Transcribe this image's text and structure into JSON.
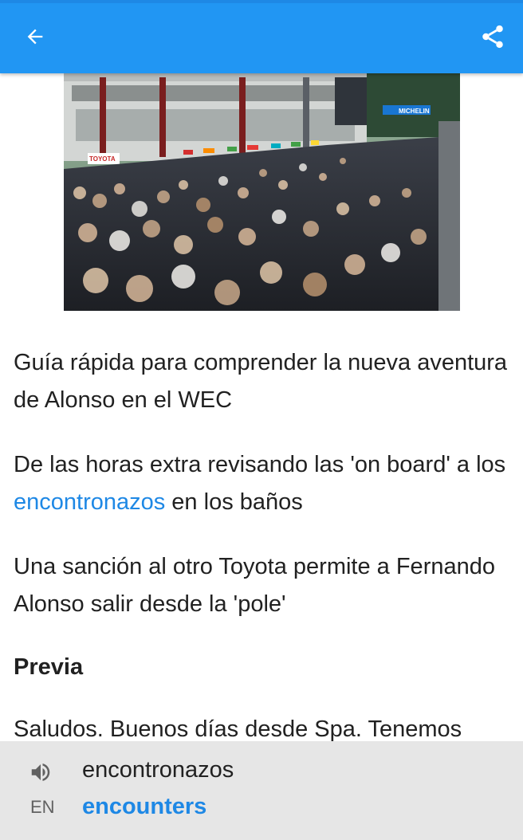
{
  "appbar": {
    "back_icon": "arrow-back-icon",
    "share_icon": "share-icon",
    "color": "#2196f3"
  },
  "hero_image": {
    "signage": [
      "TOYOTA",
      "MICHELIN"
    ]
  },
  "article": {
    "related_1": "Guía rápida para comprender la nueva aventura de Alonso en el WEC",
    "related_2_before": "De las horas extra revisando las 'on board' a los ",
    "related_2_link": "encontronazos",
    "related_2_after": " en los baños",
    "related_3": "Una sanción al otro Toyota permite a Fernando Alonso salir desde la 'pole'",
    "section_heading": "Previa",
    "intro": "Saludos. Buenos días desde Spa. Tenemos"
  },
  "translation": {
    "speaker_icon": "speaker-icon",
    "source_word": "encontronazos",
    "target_lang": "EN",
    "translated_word": "encounters",
    "accent": "#1e88e5"
  }
}
